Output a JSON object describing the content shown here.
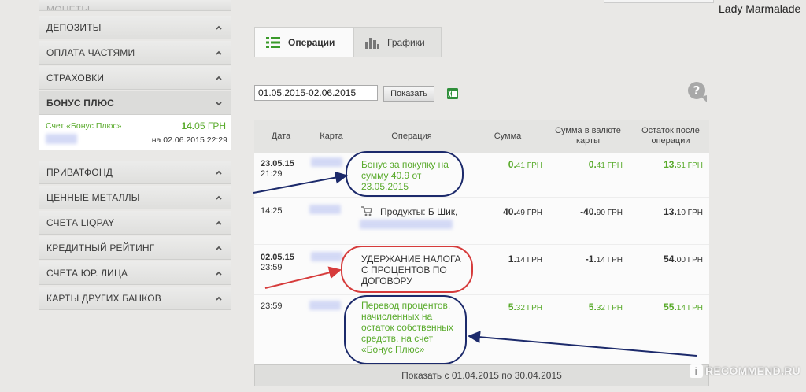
{
  "header": {
    "username": "Lady Marmalade"
  },
  "sidebar": {
    "clipped_item": "МОНЕТЫ",
    "items_top": [
      "ДЕПОЗИТЫ",
      "ОПЛАТА ЧАСТЯМИ",
      "СТРАХОВКИ"
    ],
    "active_item": "БОНУС ПЛЮС",
    "bonus": {
      "account_label": "Счет «Бонус Плюс»",
      "amount_int": "14.",
      "amount_frac": "05 ГРН",
      "date": "на 02.06.2015 22:29"
    },
    "items_bottom": [
      "ПРИВАТФОНД",
      "ЦЕННЫЕ МЕТАЛЛЫ",
      "СЧЕТА LIQPAY",
      "КРЕДИТНЫЙ РЕЙТИНГ",
      "СЧЕТА ЮР. ЛИЦА",
      "КАРТЫ ДРУГИХ БАНКОВ"
    ]
  },
  "tabs": {
    "operations": "Операции",
    "charts": "Графики"
  },
  "filter": {
    "date_range": "01.05.2015-02.06.2015",
    "show_button": "Показать"
  },
  "table": {
    "headers": {
      "date": "Дата",
      "card": "Карта",
      "operation": "Операция",
      "sum": "Сумма",
      "sum_card_currency": "Сумма в валюте карты",
      "balance_after": "Остаток после операции"
    },
    "rows": [
      {
        "date": "23.05.15",
        "time": "21:29",
        "description": "Бонус за покупку на сумму 40.9 от 23.05.2015",
        "sum": {
          "int": "0.",
          "frac": "41 ГРН"
        },
        "sum_card": {
          "int": "0.",
          "frac": "41 ГРН"
        },
        "balance": {
          "int": "13.",
          "frac": "51 ГРН"
        }
      },
      {
        "date": "",
        "time": "14:25",
        "description": "Продукты: Б Шик,",
        "sum": {
          "int": "40.",
          "frac": "49 ГРН"
        },
        "sum_card": {
          "int": "-40.",
          "frac": "90 ГРН"
        },
        "balance": {
          "int": "13.",
          "frac": "10 ГРН"
        }
      },
      {
        "date": "02.05.15",
        "time": "23:59",
        "description": "УДЕРЖАНИЕ НАЛОГА С ПРОЦЕНТОВ ПО ДОГОВОРУ",
        "sum": {
          "int": "1.",
          "frac": "14 ГРН"
        },
        "sum_card": {
          "int": "-1.",
          "frac": "14 ГРН"
        },
        "balance": {
          "int": "54.",
          "frac": "00 ГРН"
        }
      },
      {
        "date": "",
        "time": "23:59",
        "description": "Перевод процентов, начисленных на остаток собственных средств, на счет «Бонус Плюс»",
        "sum": {
          "int": "5.",
          "frac": "32 ГРН"
        },
        "sum_card": {
          "int": "5.",
          "frac": "32 ГРН"
        },
        "balance": {
          "int": "55.",
          "frac": "14 ГРН"
        }
      }
    ]
  },
  "footer": {
    "show_period": "Показать с 01.04.2015 по 30.04.2015"
  },
  "watermark": {
    "icon": "i",
    "text": "RECOMMEND.RU"
  },
  "colors": {
    "accent_green": "#5aab2c",
    "annotation_navy": "#1c2a6b",
    "annotation_red": "#d63b3b"
  }
}
